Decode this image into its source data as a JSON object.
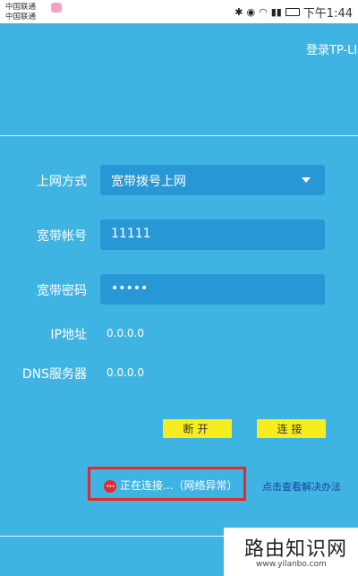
{
  "statusbar": {
    "carrier1": "中国联通",
    "carrier2": "中国联通",
    "icons": [
      "bluetooth-icon",
      "eye-icon",
      "wifi-icon",
      "4g-signal-icon",
      "battery-icon"
    ],
    "time": "下午1:44"
  },
  "header": {
    "title": "登录TP-LINK"
  },
  "form": {
    "connection_type_label": "上网方式",
    "connection_type_value": "宽带拨号上网",
    "account_label": "宽带帐号",
    "account_value": "11111",
    "password_label": "宽带密码",
    "password_value": "•••••",
    "ip_label": "IP地址",
    "ip_value": "0.0.0.0",
    "dns_label": "DNS服务器",
    "dns_value": "0.0.0.0"
  },
  "buttons": {
    "disconnect": "断开",
    "connect": "连接"
  },
  "status": {
    "text": "正在连接...（网络异常）",
    "help_link": "点击查看解决办法"
  },
  "watermark": {
    "title": "路由知识网",
    "url": "www.yilanbo.com"
  },
  "colors": {
    "background": "#3fb4e2",
    "field": "#2797d6",
    "button": "#f7ec1e",
    "highlight": "#e8262b",
    "link": "#1a3f9e"
  }
}
